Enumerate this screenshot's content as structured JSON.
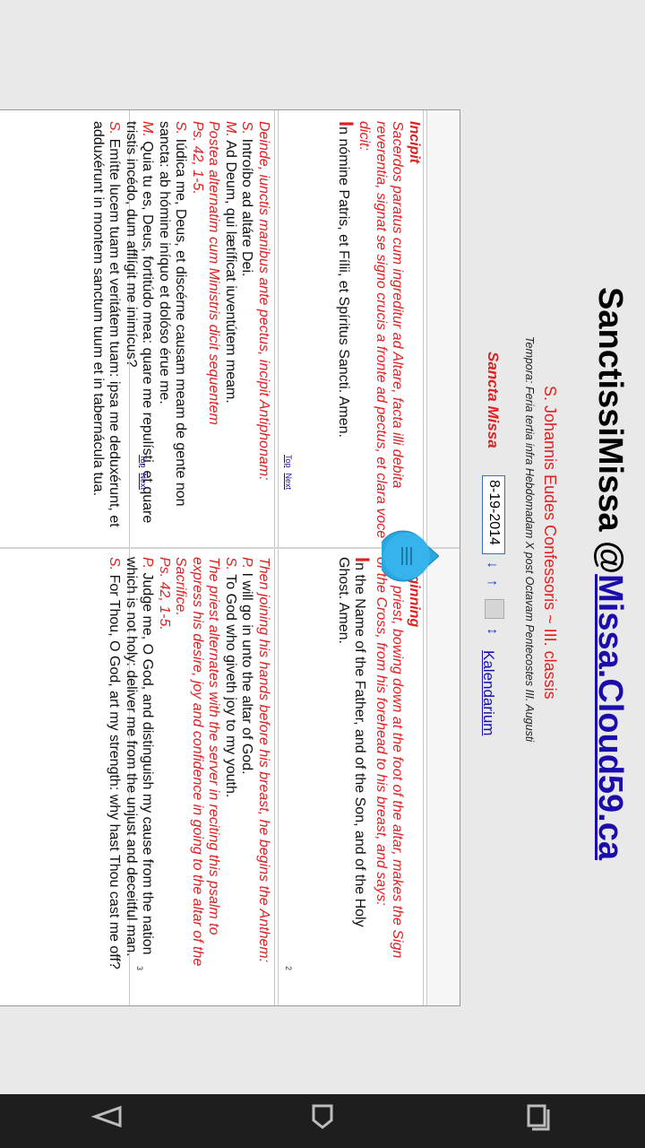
{
  "header": {
    "title_prefix": "SanctissiMissa @",
    "title_link": "Missa.Cloud59.ca",
    "feast": "S. Johannis Eudes Confessoris ~ III. classis",
    "tempora": "Tempora: Feria tertia infra Hebdomadam X post Octavam Pentecostes III. Augusti",
    "sancta_missa": "Sancta Missa",
    "date_value": "8-19-2014",
    "calendar_link": "Kalendarium",
    "anchor_link": "Al"
  },
  "row1": {
    "number": "2",
    "latin": {
      "heading": "Incipit",
      "rubric": "Sacerdos paratus cum ingreditur ad Altare, facta illi debita reverentia, signat se signo crucis a fronte ad pectus, et clara voce dicit:",
      "initial": "I",
      "text": "n nómine Patris,   et Fílii, et Spíritus Sancti. Amen."
    },
    "english": {
      "heading": "Beginning",
      "rubric": "The priest, bowing down at the foot of the altar, makes the Sign of the Cross, from his forehead to his breast, and says:",
      "initial": "I",
      "text": "n the Name of the Father, and of the Son,   and of the Holy Ghost. Amen."
    },
    "top": "Top",
    "next": "Next"
  },
  "row2": {
    "number": "3",
    "latin": {
      "rubric1": "Deinde, iunctis manibus ante pectus, incipit Antiphonam:",
      "l1": "Introíbo ad altáre Dei.",
      "l2": "Ad Deum, qui lætíficat iuventútem meam.",
      "rubric2": "Postea alternatim cum Ministris dicit sequentem",
      "ps": "Ps. 42, 1-5.",
      "l3": "Iúdica me, Deus, et discérne causam meam de gente non sancta: ab hómine iníquo et dolóso érue me.",
      "l4": "Quia tu es, Deus, fortitúdo mea: quare me repulísti, et quare tristis incédo, dum afflígit me inimícus?",
      "l5": "Emítte lucem tuam et veritátem tuam: ipsa me deduxérunt, et adduxérunt in montem sanctum tuum et in tabernácula tua."
    },
    "english": {
      "rubric1": "Then joining his hands before his breast, he begins the Anthem:",
      "l1": "I will go in unto the altar of God.",
      "l2": "To God who giveth joy to my youth.",
      "rubric2": "The priest alternates with the server in reciting this psalm to express his desire, joy and confidence in going to the altar of the Sacrifice.",
      "ps": "Ps. 42, 1-5.",
      "l3": "Judge me, O God, and distinguish my cause from the nation which is not holy: deliver me from the unjust and deceitful man.",
      "l4": "For Thou, O God, art my strength: why hast Thou cast me off?"
    },
    "top": "Top",
    "next": "Next"
  },
  "speakers": {
    "s": "S.",
    "m": "M.",
    "p": "P."
  },
  "nav": {
    "back": "back-icon",
    "home": "home-icon",
    "recents": "recents-icon"
  }
}
